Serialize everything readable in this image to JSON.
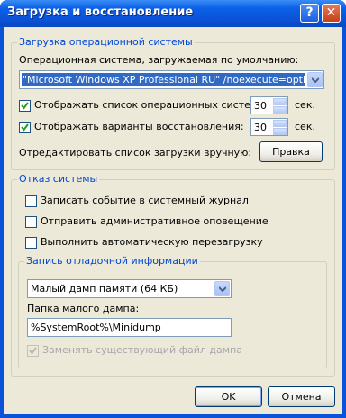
{
  "window": {
    "title": "Загрузка и восстановление",
    "help_glyph": "?",
    "close_glyph": "✕"
  },
  "os_startup": {
    "legend": "Загрузка операционной системы",
    "default_os_label": "Операционная система, загружаемая по умолчанию:",
    "default_os_value": "\"Microsoft Windows XP Professional RU\" /noexecute=optin /fastdetect",
    "show_os_list_label": "Отображать список операционных систем:",
    "show_os_list_checked": true,
    "show_os_list_seconds": "30",
    "show_recovery_label": "Отображать варианты восстановления:",
    "show_recovery_checked": true,
    "show_recovery_seconds": "30",
    "seconds_unit": "сек.",
    "edit_label": "Отредактировать список загрузки вручную:",
    "edit_button": "Правка"
  },
  "system_failure": {
    "legend": "Отказ системы",
    "write_event_label": "Записать событие в системный журнал",
    "write_event_checked": false,
    "send_alert_label": "Отправить административное оповещение",
    "send_alert_checked": false,
    "auto_restart_label": "Выполнить автоматическую перезагрузку",
    "auto_restart_checked": false
  },
  "debug_info": {
    "legend": "Запись отладочной информации",
    "dump_type_value": "Малый дамп памяти (64 КБ)",
    "folder_label": "Папка малого дампа:",
    "folder_value": "%SystemRoot%\\Minidump",
    "overwrite_label": "Заменять существующий файл дампа",
    "overwrite_checked": true,
    "overwrite_enabled": false
  },
  "buttons": {
    "ok": "OK",
    "cancel": "Отмена"
  }
}
